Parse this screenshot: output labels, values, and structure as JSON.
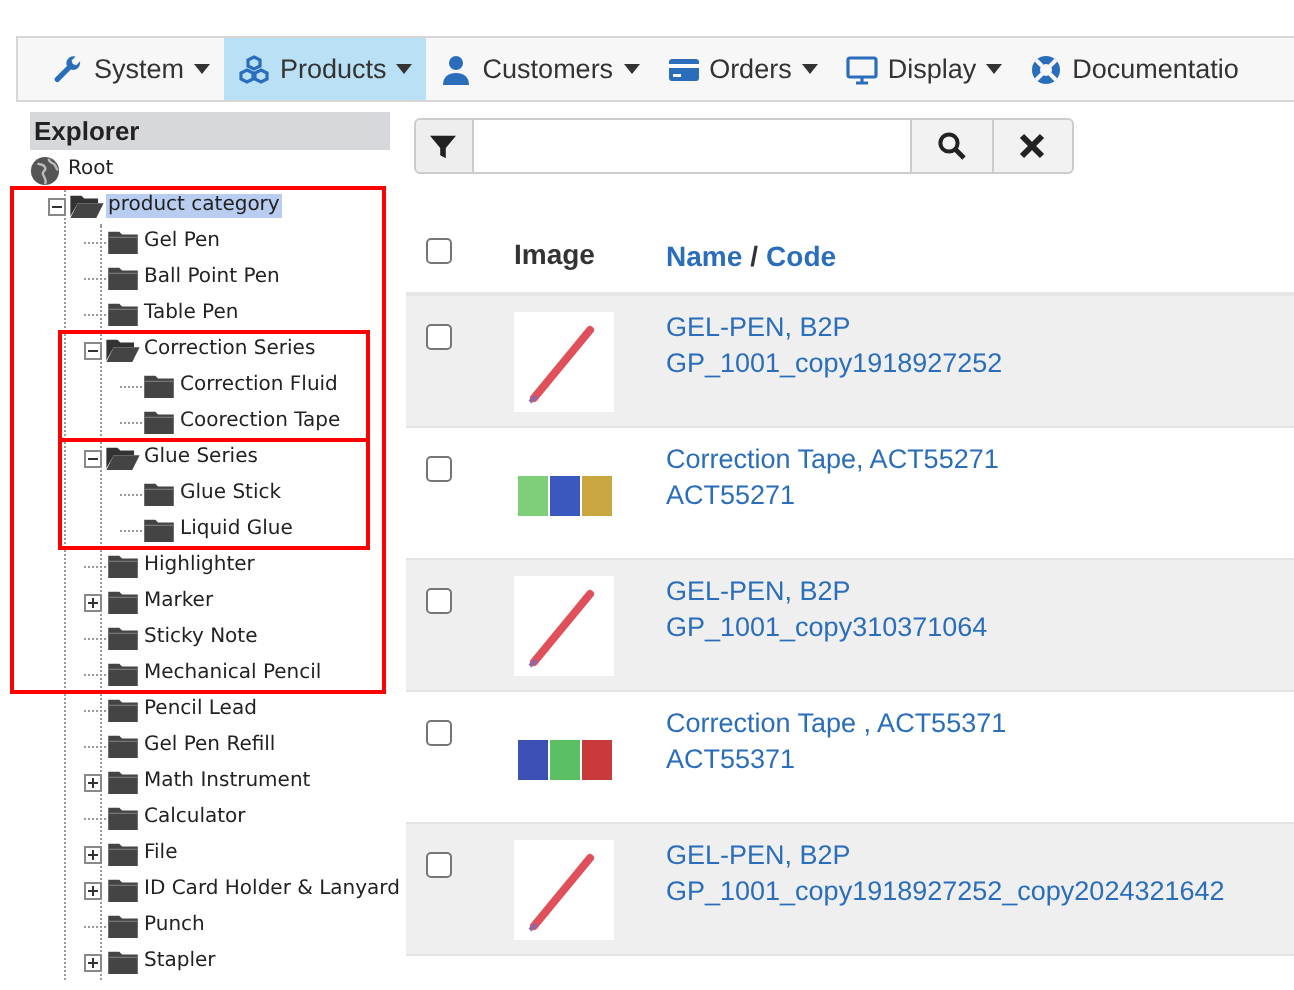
{
  "nav": [
    {
      "label": "System",
      "selected": false,
      "caret": true
    },
    {
      "label": "Products",
      "selected": true,
      "caret": true
    },
    {
      "label": "Customers",
      "selected": false,
      "caret": true
    },
    {
      "label": "Orders",
      "selected": false,
      "caret": true
    },
    {
      "label": "Display",
      "selected": false,
      "caret": true
    },
    {
      "label": "Documentatio",
      "selected": false,
      "caret": false
    }
  ],
  "explorer": {
    "title": "Explorer",
    "root": "Root",
    "tree": [
      {
        "label": "product category",
        "selected": true,
        "expanded": true,
        "frame_start": true,
        "children": [
          {
            "label": "Gel Pen",
            "selected": false
          },
          {
            "label": "Ball Point Pen",
            "selected": false
          },
          {
            "label": "Table Pen",
            "selected": false
          },
          {
            "label": "Correction Series",
            "selected": false,
            "expanded": true,
            "frame_start": true,
            "children": [
              {
                "label": "Correction Fluid",
                "selected": false
              },
              {
                "label": "Coorection Tape",
                "selected": false,
                "frame_end": true
              }
            ]
          },
          {
            "label": "Glue Series",
            "selected": false,
            "expanded": true,
            "frame_start": true,
            "children": [
              {
                "label": "Glue Stick",
                "selected": false
              },
              {
                "label": "Liquid Glue",
                "selected": false,
                "frame_end": true
              }
            ]
          },
          {
            "label": "Highlighter",
            "selected": false
          },
          {
            "label": "Marker",
            "selected": false,
            "expanded": false
          },
          {
            "label": "Sticky Note",
            "selected": false
          },
          {
            "label": "Mechanical Pencil",
            "selected": false,
            "frame_end": true
          },
          {
            "label": "Pencil Lead",
            "selected": false
          },
          {
            "label": "Gel Pen Refill",
            "selected": false
          },
          {
            "label": "Math Instrument",
            "selected": false,
            "expanded": false
          },
          {
            "label": "Calculator",
            "selected": false
          },
          {
            "label": "File",
            "selected": false,
            "expanded": false
          },
          {
            "label": "ID Card Holder & Lanyard",
            "selected": false,
            "expanded": false
          },
          {
            "label": "Punch",
            "selected": false
          },
          {
            "label": "Stapler",
            "selected": false,
            "expanded": false
          }
        ]
      }
    ]
  },
  "table": {
    "columns": {
      "select_all_checked": false,
      "image": "Image",
      "name": "Name",
      "separator": "/",
      "code": "Code"
    },
    "rows": [
      {
        "checked": false,
        "kind": "pen",
        "name": "GEL-PEN, B2P",
        "code": "GP_1001_copy1918927252"
      },
      {
        "checked": false,
        "kind": "tape",
        "name": "Correction Tape, ACT55271",
        "code": "ACT55271"
      },
      {
        "checked": false,
        "kind": "pen",
        "name": "GEL-PEN, B2P",
        "code": "GP_1001_copy310371064"
      },
      {
        "checked": false,
        "kind": "tape",
        "name": "Correction Tape , ACT55371",
        "code": "ACT55371"
      },
      {
        "checked": false,
        "kind": "pen",
        "name": "GEL-PEN, B2P",
        "code": "GP_1001_copy1918927252_copy2024321642"
      }
    ]
  }
}
